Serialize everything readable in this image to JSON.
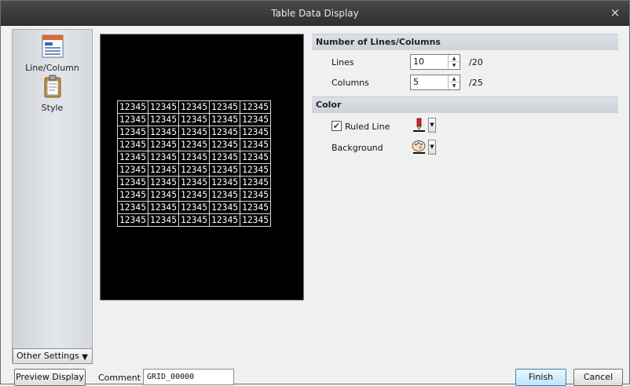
{
  "window": {
    "title": "Table Data Display",
    "close_glyph": "×"
  },
  "sidebar": {
    "items": [
      {
        "label": "Line/Column",
        "icon": "table-icon",
        "active": true
      },
      {
        "label": "Style",
        "icon": "clipboard-icon",
        "active": false
      }
    ],
    "other_settings_label": "Other Settings"
  },
  "preview": {
    "rows": 10,
    "columns": 5,
    "cell_text": "12345",
    "background": "#000000",
    "text_color": "#ffffff",
    "grid_line_color": "#d9d9d9"
  },
  "lines_columns_section": {
    "heading": "Number of Lines/Columns",
    "lines": {
      "label": "Lines",
      "value": "10",
      "max": "/20"
    },
    "columns": {
      "label": "Columns",
      "value": "5",
      "max": "/25"
    }
  },
  "color_section": {
    "heading": "Color",
    "ruled_line": {
      "label": "Ruled Line",
      "checked": true,
      "icon": "pen-color-icon"
    },
    "background": {
      "label": "Background",
      "icon": "palette-icon"
    }
  },
  "footer": {
    "preview_button": "Preview Display",
    "comment_label": "Comment",
    "comment_value": "GRID_00000",
    "finish_button": "Finish",
    "cancel_button": "Cancel"
  },
  "colors": {
    "titlebar": "#3a3a3a",
    "section_header": "#d4d8de",
    "accent_focus": "#3c7fb1"
  }
}
